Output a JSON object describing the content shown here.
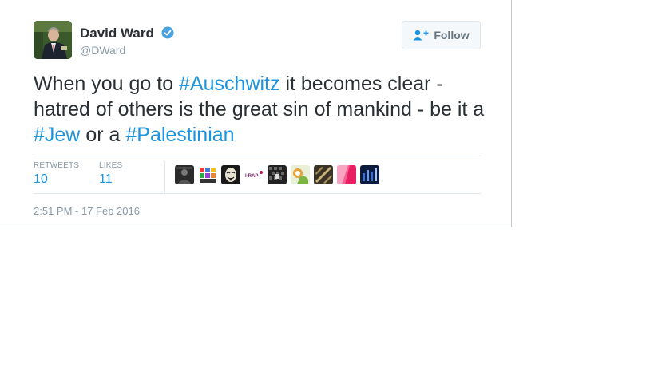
{
  "user": {
    "name": "David Ward",
    "handle": "@DWard",
    "verified": true,
    "avatar_icon": "profile-photo"
  },
  "follow": {
    "label": "Follow",
    "icon": "add-user-icon"
  },
  "tweet": {
    "segments": [
      {
        "text": "When you go to ",
        "type": "text"
      },
      {
        "text": "#Auschwitz",
        "type": "hashtag"
      },
      {
        "text": " it becomes clear - hatred of others is the great sin of mankind - be it a ",
        "type": "text"
      },
      {
        "text": "#Jew",
        "type": "hashtag"
      },
      {
        "text": " or a ",
        "type": "text"
      },
      {
        "text": "#Palestinian",
        "type": "hashtag"
      }
    ]
  },
  "stats": {
    "retweets_label": "RETWEETS",
    "retweets_value": "10",
    "likes_label": "LIKES",
    "likes_value": "11"
  },
  "likers": [
    {
      "name": "liker-avatar-1"
    },
    {
      "name": "liker-avatar-2"
    },
    {
      "name": "liker-avatar-3"
    },
    {
      "name": "liker-avatar-4"
    },
    {
      "name": "liker-avatar-5"
    },
    {
      "name": "liker-avatar-6"
    },
    {
      "name": "liker-avatar-7"
    },
    {
      "name": "liker-avatar-8"
    },
    {
      "name": "liker-avatar-9"
    }
  ],
  "timestamp": "2:51 PM - 17 Feb 2016",
  "colors": {
    "link": "#1b95e0",
    "text": "#292f33",
    "muted": "#8899a6",
    "verified": "#1da1f2"
  }
}
